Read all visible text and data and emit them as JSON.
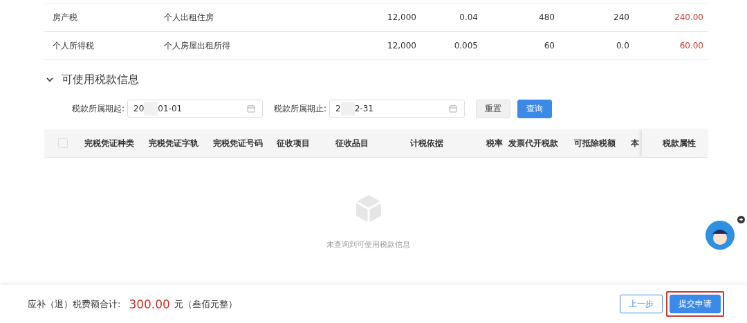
{
  "tax_rows": [
    {
      "tax_type": "房产税",
      "item": "个人出租住房",
      "basis": "12,000",
      "rate": "0.04",
      "tax_amount": "480",
      "reduction": "240",
      "payable": "240.00"
    },
    {
      "tax_type": "个人所得税",
      "item": "个人房屋出租所得",
      "basis": "12,000",
      "rate": "0.005",
      "tax_amount": "60",
      "reduction": "0.0",
      "payable": "60.00"
    }
  ],
  "section": {
    "title": "可使用税款信息",
    "expanded": true
  },
  "filters": [
    {
      "label": "税款所属期起:",
      "value_before": "20",
      "value_after": "01-01"
    },
    {
      "label": "税款所属期止:",
      "value_before": "2",
      "value_after": "2-31"
    }
  ],
  "filter_buttons": [
    {
      "label": "重置",
      "kind": "default"
    },
    {
      "label": "查询",
      "kind": "primary"
    }
  ],
  "table": {
    "select_all": {
      "checked": false
    },
    "columns": [
      "完税凭证种类",
      "完税凭证字轨",
      "完税凭证号码",
      "征收项目",
      "征收品目",
      "计税依据",
      "税率",
      "发票代开税款",
      "可抵除税额",
      "本",
      "税款属性"
    ],
    "empty_text": "未查询到可使用税款信息"
  },
  "footer": {
    "label": "应补（退）税费额合计:",
    "amount": "300.00",
    "unit": "元（叁佰元整）",
    "buttons": [
      {
        "label": "上一步",
        "kind": "default",
        "highlighted": false
      },
      {
        "label": "提交申请",
        "kind": "primary",
        "highlighted": true
      }
    ]
  }
}
